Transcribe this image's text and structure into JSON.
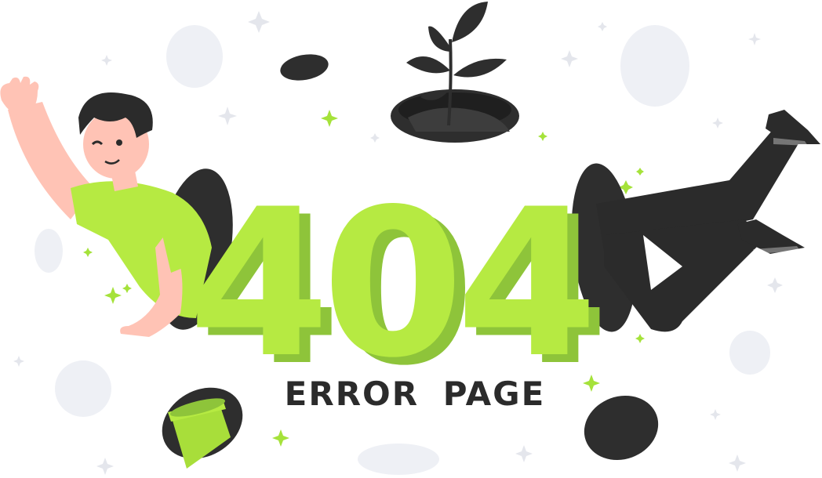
{
  "error_code": "404",
  "error_caption": "ERROR PAGE",
  "colors": {
    "accent_green": "#b6ea42",
    "accent_green_shadow": "#8ec43a",
    "dark": "#2b2b2b",
    "hole": "#2e2e2e",
    "skin": "#ffc3b5",
    "cloud": "#eef0f5",
    "sparkle": "#e7e9ef"
  },
  "icons": [
    "sparkle-icon",
    "plant-icon",
    "flower-pot-icon"
  ]
}
